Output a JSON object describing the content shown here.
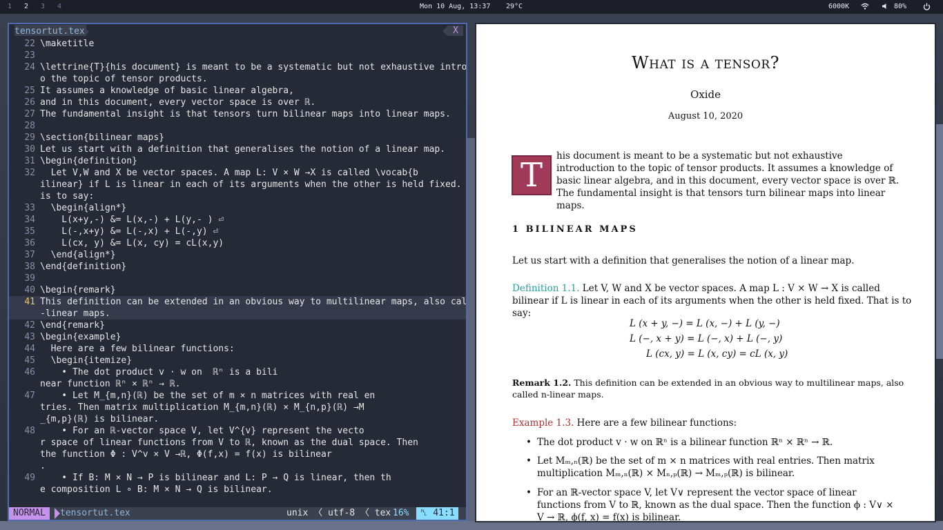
{
  "topbar": {
    "workspaces": [
      "1",
      "2",
      "3",
      "4"
    ],
    "active_workspace": "2",
    "datetime": "Mon 10 Aug, 13:37",
    "temperature": "29°C",
    "network_speed": "6000K",
    "volume": "80%"
  },
  "editor": {
    "tab_name": "tensortut.tex",
    "tab_close": "X",
    "lines": [
      {
        "n": "22",
        "t": "\\maketitle"
      },
      {
        "n": "23",
        "t": ""
      },
      {
        "n": "24",
        "t": "\\lettrine{T}{his document} is meant to be a systematic but not exhaustive introduction t"
      },
      {
        "n": "",
        "t": "o the topic of tensor products."
      },
      {
        "n": "25",
        "t": "It assumes a knowledge of basic linear algebra,"
      },
      {
        "n": "26",
        "t": "and in this document, every vector space is over ℝ."
      },
      {
        "n": "27",
        "t": "The fundamental insight is that tensors turn bilinear maps into linear maps."
      },
      {
        "n": "28",
        "t": ""
      },
      {
        "n": "29",
        "t": "\\section{bilinear maps}"
      },
      {
        "n": "30",
        "t": "Let us start with a definition that generalises the notion of a linear map."
      },
      {
        "n": "31",
        "t": "\\begin{definition}"
      },
      {
        "n": "32",
        "t": "  Let V,W and X be vector spaces. A map L: V × W →X is called \\vocab{b"
      },
      {
        "n": "",
        "t": "ilinear} if L is linear in each of its arguments when the other is held fixed. That"
      },
      {
        "n": "",
        "t": "is to say:"
      },
      {
        "n": "33",
        "t": "  \\begin{align*}"
      },
      {
        "n": "34",
        "t": "    L(x+y,-) &= L(x,-) + L(y,- ) ⏎"
      },
      {
        "n": "35",
        "t": "    L(-,x+y) &= L(-,x) + L(-,y) ⏎"
      },
      {
        "n": "36",
        "t": "    L(cx, y) &= L(x, cy) = cL(x,y)"
      },
      {
        "n": "37",
        "t": "  \\end{align*}"
      },
      {
        "n": "38",
        "t": "\\end{definition}"
      },
      {
        "n": "39",
        "t": ""
      },
      {
        "n": "40",
        "t": "\\begin{remark}"
      },
      {
        "n": "41",
        "t": "This definition can be extended in an obvious way to multilinear maps, also called \\(n\\)"
      },
      {
        "n": "",
        "t": "-linear maps."
      },
      {
        "n": "42",
        "t": "\\end{remark}"
      },
      {
        "n": "43",
        "t": "\\begin{example}"
      },
      {
        "n": "44",
        "t": "  Here are a few bilinear functions:"
      },
      {
        "n": "45",
        "t": "  \\begin{itemize}"
      },
      {
        "n": "46",
        "t": "    • The dot product v · w on  ℝⁿ is a bili"
      },
      {
        "n": "",
        "t": "near function ℝⁿ × ℝⁿ → ℝ."
      },
      {
        "n": "47",
        "t": "    • Let M_{m,n}(ℝ) be the set of m × n matrices with real en"
      },
      {
        "n": "",
        "t": "tries. Then matrix multiplication M_{m,n}(ℝ) × M_{n,p}(ℝ) →M"
      },
      {
        "n": "",
        "t": "_{m,p}(ℝ) is bilinear."
      },
      {
        "n": "48",
        "t": "    • For an ℝ-vector space V, let V^{v} represent the vecto"
      },
      {
        "n": "",
        "t": "r space of linear functions from V to ℝ, known as the dual space. Then"
      },
      {
        "n": "",
        "t": "the function Φ : V^v × V →ℝ, Φ(f,x) = f(x) is bilinear"
      },
      {
        "n": "",
        "t": "."
      },
      {
        "n": "49",
        "t": "    • If B: M × N → P is bilinear and L: P → Q is linear, then th"
      },
      {
        "n": "",
        "t": "e composition L ∘ B: M × N → Q is bilinear."
      }
    ],
    "status": {
      "mode": "NORMAL",
      "file": "tensortut.tex",
      "info": "unix 〈 utf-8 〈 tex",
      "percent": "16%",
      "position": "␤  41:1"
    }
  },
  "pdf": {
    "title": "What is a tensor?",
    "author": "Oxide",
    "date": "August 10, 2020",
    "dropcap": "T",
    "intro": "his document is meant to be a systematic but not exhaustive introduction to the topic of tensor products. It assumes a knowledge of basic linear algebra, and in this document, every vector space is over ℝ. The fundamental insight is that tensors turn bilinear maps into linear maps.",
    "section": "1  BILINEAR  MAPS",
    "para1": "Let us start with a definition that generalises the notion of a linear map.",
    "def_label": "Definition 1.1.",
    "def_text": " Let V, W and X be vector spaces. A map L : V × W → X is called bilinear if L is linear in each of its arguments when the other is held fixed. That is to say:",
    "eq1": "L (x + y, −) = L (x, −) + L (y, −)",
    "eq2": "L (−, x + y) = L (−, x) + L (−, y)",
    "eq3": "L (cx, y) = L (x, cy) = cL (x, y)",
    "rem_label": "Remark 1.2.",
    "rem_text": " This definition can be extended in an obvious way to multilinear maps, also called n-linear maps.",
    "ex_label": "Example 1.3.",
    "ex_text": " Here are a few bilinear functions:",
    "items": [
      "The dot product v · w on ℝⁿ is a bilinear function ℝⁿ × ℝⁿ → ℝ.",
      "Let Mₘ,ₙ(ℝ) be the set of m × n matrices with real entries. Then matrix multiplication Mₘ,ₙ(ℝ) × Mₙ,ₚ(ℝ) → Mₘ,ₚ(ℝ) is bilinear.",
      "For an ℝ-vector space V, let V∨ represent the vector space of linear functions from V to ℝ, known as the dual space. Then the function ϕ : V∨ × V → ℝ, ϕ(f, x) = f(x) is bilinear."
    ]
  }
}
